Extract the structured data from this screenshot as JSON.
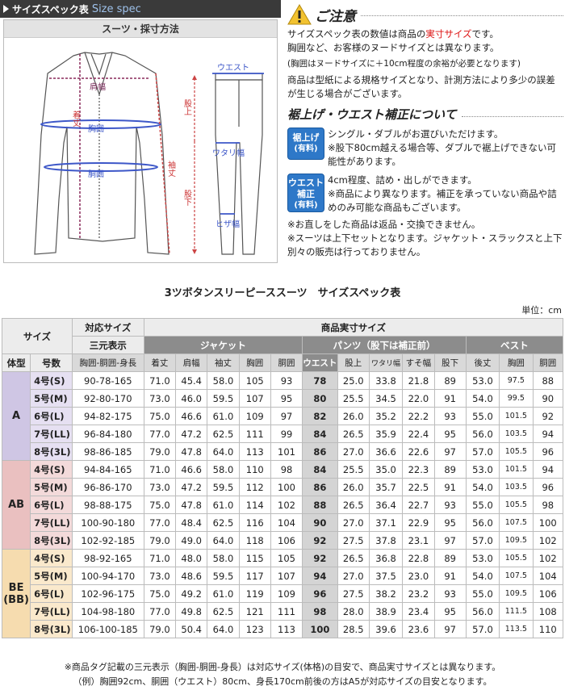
{
  "header": {
    "title_jp": "サイズスペック表",
    "title_en": "Size spec"
  },
  "measure": {
    "title": "スーツ・採寸方法",
    "labels": {
      "katahaba": "肩幅",
      "kitake": "着丈",
      "munamawari": "胸囲",
      "domawari": "胴囲",
      "sodetake": "袖丈",
      "west": "ウエスト",
      "matagami": "股上",
      "watarihaba": "ワタリ幅",
      "matashita": "股下",
      "hizahaba": "ヒザ幅"
    }
  },
  "caution": {
    "title": "ご注意",
    "p1_a": "サイズスペック表の数値は商品の",
    "p1_red": "実寸サイズ",
    "p1_b": "です。",
    "p2": "胸囲など、お客様のヌードサイズとは異なります。",
    "p3": "(胸囲はヌードサイズに＋10cm程度の余裕が必要となります)",
    "p4": "商品は型紙による規格サイズとなり、計測方法により多少の誤差が生じる場合がございます。",
    "sub_title": "裾上げ・ウエスト補正について",
    "badge1_l1": "裾上げ",
    "badge1_l2": "(有料)",
    "b1_t1": "シングル・ダブルがお選びいただけます。",
    "b1_t2": "※股下80cm越える場合等、ダブルで裾上げできない可能性があります。",
    "badge2_l1": "ウエスト",
    "badge2_l2": "補正",
    "badge2_l3": "(有料)",
    "b2_t1": "4cm程度、詰め・出しができます。",
    "b2_t2": "※商品により異なります。補正を承っていない商品や詰めのみ可能な商品もございます。",
    "n1": "※お直しをした商品は返品・交換できません。",
    "n2": "※スーツは上下セットとなります。ジャケット・スラックスと上下別々の販売は行っておりません。"
  },
  "table": {
    "title": "3ツボタンスリーピーススーツ　サイズスペック表",
    "unit": "単位：cm",
    "h": {
      "size": "サイズ",
      "taiou": "対応サイズ",
      "sangen": "三元表示",
      "jissun": "商品実寸サイズ",
      "jacket": "ジャケット",
      "pants": "パンツ（股下は補正前）",
      "vest": "ベスト",
      "taikei": "体型",
      "gousu": "号数",
      "sangen_sub": "胸囲-胴囲-身長",
      "j": [
        "着丈",
        "肩幅",
        "袖丈",
        "胸囲",
        "胴囲"
      ],
      "p": [
        "ウエスト",
        "股上",
        "ワタリ幅",
        "すそ幅",
        "股下"
      ],
      "v": [
        "後丈",
        "胸囲",
        "胴囲"
      ]
    },
    "groups": [
      {
        "name": "A",
        "rows": [
          {
            "size": "4号(S)",
            "sangen": "90-78-165",
            "j": [
              "71.0",
              "45.4",
              "58.0",
              "105",
              "93"
            ],
            "p": [
              "78",
              "25.0",
              "33.8",
              "21.8",
              "89"
            ],
            "v": [
              "53.0",
              "97.5",
              "88"
            ]
          },
          {
            "size": "5号(M)",
            "sangen": "92-80-170",
            "j": [
              "73.0",
              "46.0",
              "59.5",
              "107",
              "95"
            ],
            "p": [
              "80",
              "25.5",
              "34.5",
              "22.0",
              "91"
            ],
            "v": [
              "54.0",
              "99.5",
              "90"
            ]
          },
          {
            "size": "6号(L)",
            "sangen": "94-82-175",
            "j": [
              "75.0",
              "46.6",
              "61.0",
              "109",
              "97"
            ],
            "p": [
              "82",
              "26.0",
              "35.2",
              "22.2",
              "93"
            ],
            "v": [
              "55.0",
              "101.5",
              "92"
            ]
          },
          {
            "size": "7号(LL)",
            "sangen": "96-84-180",
            "j": [
              "77.0",
              "47.2",
              "62.5",
              "111",
              "99"
            ],
            "p": [
              "84",
              "26.5",
              "35.9",
              "22.4",
              "95"
            ],
            "v": [
              "56.0",
              "103.5",
              "94"
            ]
          },
          {
            "size": "8号(3L)",
            "sangen": "98-86-185",
            "j": [
              "79.0",
              "47.8",
              "64.0",
              "113",
              "101"
            ],
            "p": [
              "86",
              "27.0",
              "36.6",
              "22.6",
              "97"
            ],
            "v": [
              "57.0",
              "105.5",
              "96"
            ]
          }
        ]
      },
      {
        "name": "AB",
        "rows": [
          {
            "size": "4号(S)",
            "sangen": "94-84-165",
            "j": [
              "71.0",
              "46.6",
              "58.0",
              "110",
              "98"
            ],
            "p": [
              "84",
              "25.5",
              "35.0",
              "22.3",
              "89"
            ],
            "v": [
              "53.0",
              "101.5",
              "94"
            ]
          },
          {
            "size": "5号(M)",
            "sangen": "96-86-170",
            "j": [
              "73.0",
              "47.2",
              "59.5",
              "112",
              "100"
            ],
            "p": [
              "86",
              "26.0",
              "35.7",
              "22.5",
              "91"
            ],
            "v": [
              "54.0",
              "103.5",
              "96"
            ]
          },
          {
            "size": "6号(L)",
            "sangen": "98-88-175",
            "j": [
              "75.0",
              "47.8",
              "61.0",
              "114",
              "102"
            ],
            "p": [
              "88",
              "26.5",
              "36.4",
              "22.7",
              "93"
            ],
            "v": [
              "55.0",
              "105.5",
              "98"
            ]
          },
          {
            "size": "7号(LL)",
            "sangen": "100-90-180",
            "j": [
              "77.0",
              "48.4",
              "62.5",
              "116",
              "104"
            ],
            "p": [
              "90",
              "27.0",
              "37.1",
              "22.9",
              "95"
            ],
            "v": [
              "56.0",
              "107.5",
              "100"
            ]
          },
          {
            "size": "8号(3L)",
            "sangen": "102-92-185",
            "j": [
              "79.0",
              "49.0",
              "64.0",
              "118",
              "106"
            ],
            "p": [
              "92",
              "27.5",
              "37.8",
              "23.1",
              "97"
            ],
            "v": [
              "57.0",
              "109.5",
              "102"
            ]
          }
        ]
      },
      {
        "name": "BE",
        "name2": "(BB)",
        "rows": [
          {
            "size": "4号(S)",
            "sangen": "98-92-165",
            "j": [
              "71.0",
              "48.0",
              "58.0",
              "115",
              "105"
            ],
            "p": [
              "92",
              "26.5",
              "36.8",
              "22.8",
              "89"
            ],
            "v": [
              "53.0",
              "105.5",
              "102"
            ]
          },
          {
            "size": "5号(M)",
            "sangen": "100-94-170",
            "j": [
              "73.0",
              "48.6",
              "59.5",
              "117",
              "107"
            ],
            "p": [
              "94",
              "27.0",
              "37.5",
              "23.0",
              "91"
            ],
            "v": [
              "54.0",
              "107.5",
              "104"
            ]
          },
          {
            "size": "6号(L)",
            "sangen": "102-96-175",
            "j": [
              "75.0",
              "49.2",
              "61.0",
              "119",
              "109"
            ],
            "p": [
              "96",
              "27.5",
              "38.2",
              "23.2",
              "93"
            ],
            "v": [
              "55.0",
              "109.5",
              "106"
            ]
          },
          {
            "size": "7号(LL)",
            "sangen": "104-98-180",
            "j": [
              "77.0",
              "49.8",
              "62.5",
              "121",
              "111"
            ],
            "p": [
              "98",
              "28.0",
              "38.9",
              "23.4",
              "95"
            ],
            "v": [
              "56.0",
              "111.5",
              "108"
            ]
          },
          {
            "size": "8号(3L)",
            "sangen": "106-100-185",
            "j": [
              "79.0",
              "50.4",
              "64.0",
              "123",
              "113"
            ],
            "p": [
              "100",
              "28.5",
              "39.6",
              "23.6",
              "97"
            ],
            "v": [
              "57.0",
              "113.5",
              "110"
            ]
          }
        ]
      }
    ]
  },
  "notes": {
    "n1": "※商品タグ記載の三元表示（胸囲-胴囲-身長）は対応サイズ(体格)の目安で、商品実寸サイズとは異なります。",
    "n2": "（例）胸囲92cm、胴囲（ウエスト）80cm、身長170cm前後の方はA5が対応サイズの目安となります。"
  },
  "colors": {
    "group_A": "#cfc6e4",
    "group_AB": "#eac0c0",
    "group_BE": "#f6dcaf",
    "badge": "#2e78c8",
    "red": "#d11111"
  }
}
